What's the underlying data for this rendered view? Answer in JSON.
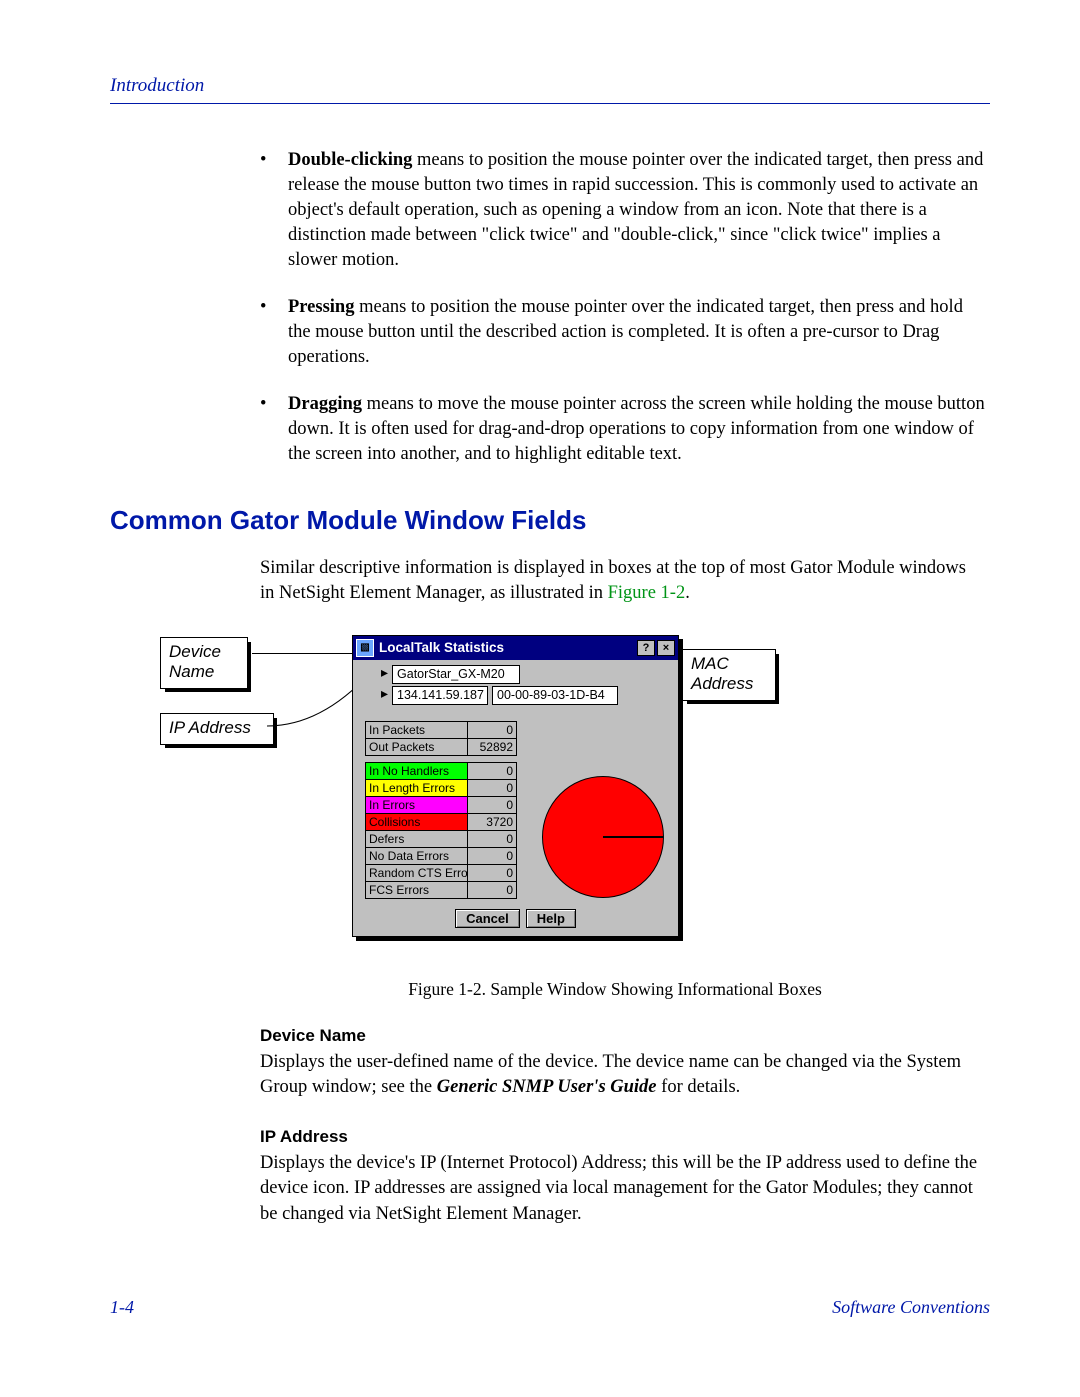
{
  "header": {
    "section": "Introduction"
  },
  "bullets": [
    {
      "term": "Double-clicking",
      "text": " means to position the mouse pointer over the indicated target, then press and release the mouse button two times in rapid succession. This is commonly used to activate an object's default operation, such as opening a window from an icon. Note that there is a distinction made between \"click twice\" and \"double-click,\" since \"click twice\" implies a slower motion."
    },
    {
      "term": "Pressing",
      "text": " means to position the mouse pointer over the indicated target, then press and hold the mouse button until the described action is completed. It is often a pre-cursor to Drag operations."
    },
    {
      "term": "Dragging",
      "text": " means to move the mouse pointer across the screen while holding the mouse button down. It is often used for drag-and-drop operations to copy information from one window of the screen into another, and to highlight editable text."
    }
  ],
  "heading": "Common Gator Module Window Fields",
  "intro": {
    "pre": "Similar descriptive information is displayed in boxes at the top of most Gator Module windows in NetSight Element Manager, as illustrated in ",
    "figref": "Figure 1-2",
    "post": "."
  },
  "callouts": {
    "device_name": "Device Name",
    "ip_address": "IP Address",
    "mac_address": "MAC Address"
  },
  "window": {
    "title": "LocalTalk Statistics",
    "help_btn": "?",
    "close_btn": "×",
    "device_name": "GatorStar_GX-M20",
    "ip": "134.141.59.187",
    "mac": "00-00-89-03-1D-B4",
    "stats_a": [
      {
        "label": "In Packets",
        "value": "0"
      },
      {
        "label": "Out Packets",
        "value": "52892"
      }
    ],
    "stats_b": [
      {
        "label": "In No Handlers",
        "value": "0",
        "bg": "#00ff00"
      },
      {
        "label": "In Length Errors",
        "value": "0",
        "bg": "#ffff00"
      },
      {
        "label": "In Errors",
        "value": "0",
        "bg": "#ff00ff"
      },
      {
        "label": "Collisions",
        "value": "3720",
        "bg": "#ff0000"
      },
      {
        "label": "Defers",
        "value": "0",
        "bg": ""
      },
      {
        "label": "No Data Errors",
        "value": "0",
        "bg": ""
      },
      {
        "label": "Random CTS Errors",
        "value": "0",
        "bg": ""
      },
      {
        "label": "FCS Errors",
        "value": "0",
        "bg": ""
      }
    ],
    "cancel": "Cancel",
    "help": "Help"
  },
  "figure_caption": "Figure 1-2. Sample Window Showing Informational Boxes",
  "definitions": [
    {
      "title": "Device Name",
      "body_pre": "Displays the user-defined name of the device. The device name can be changed via the System Group window; see the ",
      "ref": "Generic SNMP User's Guide",
      "body_post": " for details."
    },
    {
      "title": "IP Address",
      "body_pre": "Displays the device's IP (Internet Protocol) Address; this will be the IP address used to define the device icon. IP addresses are assigned via local management for the Gator Modules; they cannot be changed via NetSight Element Manager.",
      "ref": "",
      "body_post": ""
    }
  ],
  "footer": {
    "page": "1-4",
    "section": "Software Conventions"
  }
}
